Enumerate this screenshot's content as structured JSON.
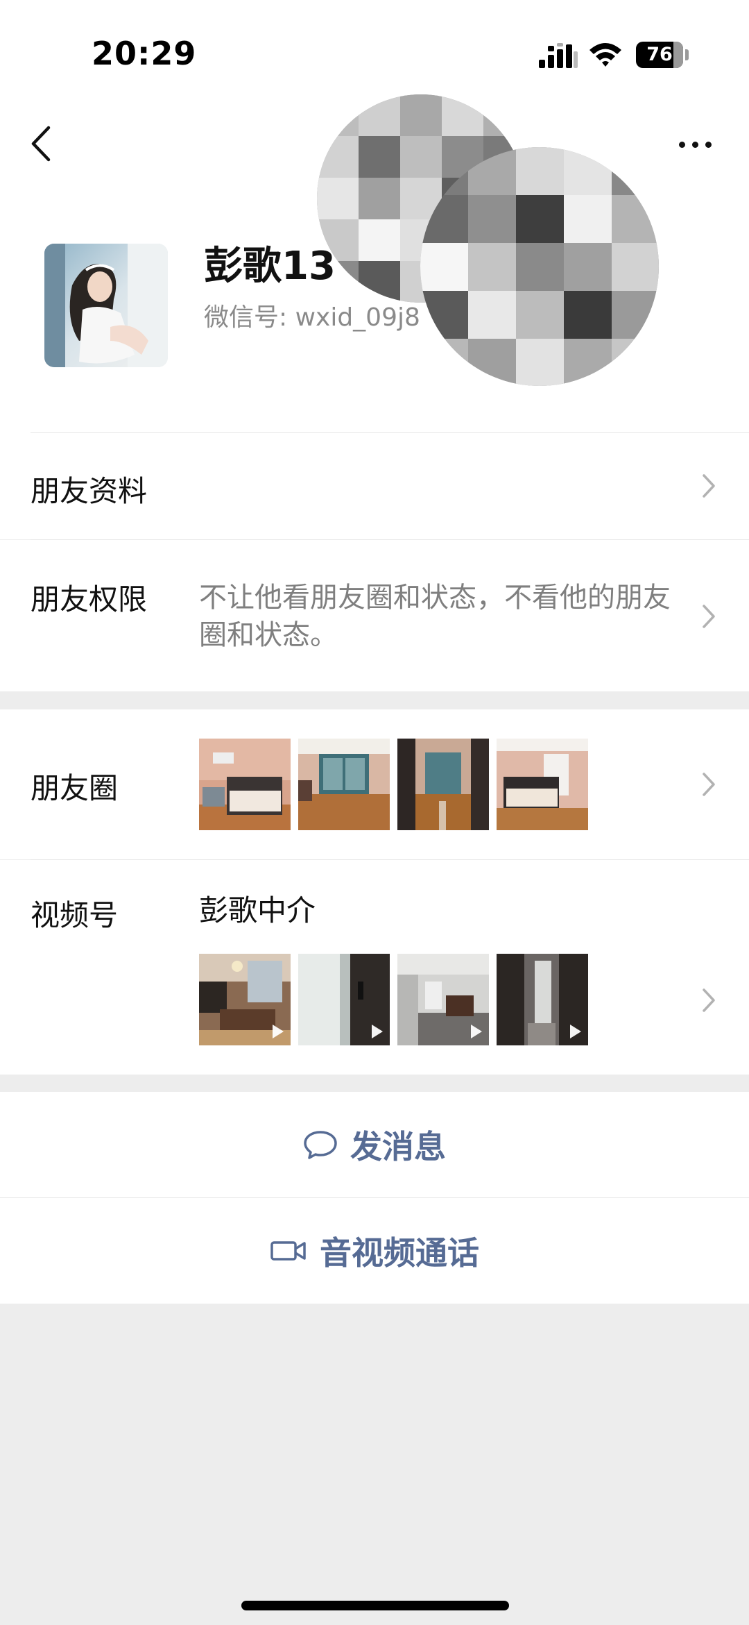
{
  "status_bar": {
    "time": "20:29",
    "battery": "76"
  },
  "header": {
    "back_icon": "chevron-left-icon",
    "more_icon": "more-dots-icon"
  },
  "profile": {
    "name": "彭歌13",
    "wxid": "微信号: wxid_09j8"
  },
  "rows": {
    "friend_info": {
      "label": "朋友资料"
    },
    "permissions": {
      "label": "朋友权限",
      "value": "不让他看朋友圈和状态，不看他的朋友圈和状态。"
    },
    "moments": {
      "label": "朋友圈"
    },
    "channels": {
      "label": "视频号",
      "value": "彭歌中介"
    }
  },
  "actions": {
    "message": "发消息",
    "call": "音视频通话"
  },
  "colors": {
    "link_blue": "#566b94",
    "background": "#ededed"
  }
}
